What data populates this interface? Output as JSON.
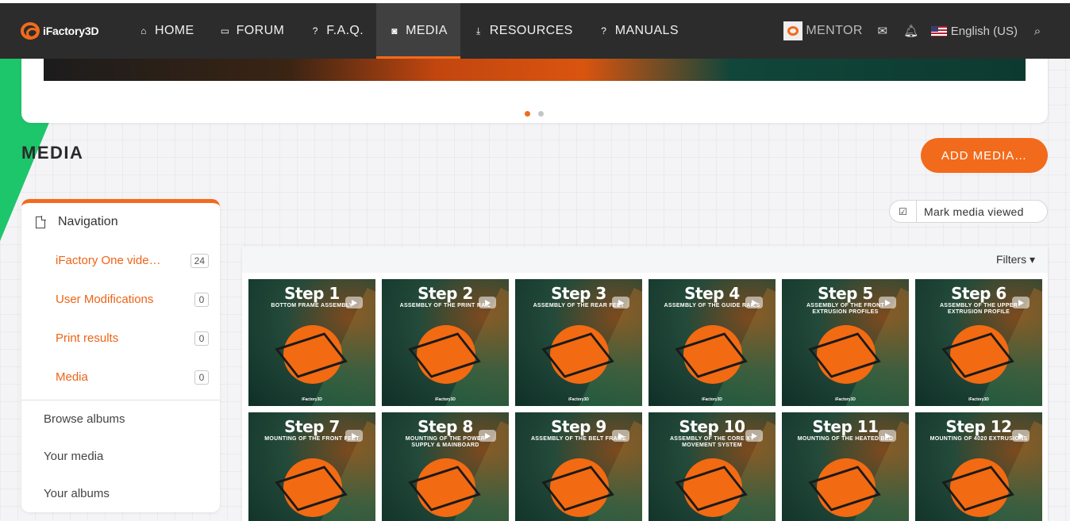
{
  "brand": {
    "name": "iFactory3D"
  },
  "nav": {
    "items": [
      {
        "label": "HOME",
        "icon": "home-icon",
        "glyph": "⌂",
        "active": false
      },
      {
        "label": "FORUM",
        "icon": "forum-icon",
        "glyph": "▭",
        "active": false
      },
      {
        "label": "F.A.Q.",
        "icon": "faq-icon",
        "glyph": "?",
        "active": false
      },
      {
        "label": "MEDIA",
        "icon": "camera-icon",
        "glyph": "◙",
        "active": true
      },
      {
        "label": "RESOURCES",
        "icon": "download-icon",
        "glyph": "⤓",
        "active": false
      },
      {
        "label": "MANUALS",
        "icon": "manual-icon",
        "glyph": "?",
        "active": false
      }
    ],
    "user": "MENTOR",
    "language": "English (US)",
    "accent_color": "#f26a1b"
  },
  "carousel": {
    "slides": 2,
    "active": 1
  },
  "page": {
    "title": "MEDIA",
    "add_media_label": "ADD MEDIA…"
  },
  "sidebar": {
    "title": "Navigation",
    "categories": [
      {
        "label": "iFactory One vide…",
        "count": "24"
      },
      {
        "label": "User Modifications",
        "count": "0"
      },
      {
        "label": "Print results",
        "count": "0"
      },
      {
        "label": "Media",
        "count": "0"
      }
    ],
    "links": [
      "Browse albums",
      "Your media",
      "Your albums"
    ]
  },
  "mark_viewed_label": "Mark media viewed",
  "gallery": {
    "filters_label": "Filters ▾",
    "logo_text": "iFactory3D",
    "tiles": [
      {
        "step": "Step 1",
        "subtitle": "BOTTOM FRAME ASSEMBLY"
      },
      {
        "step": "Step 2",
        "subtitle": "ASSEMBLY OF THE PRINT RAIL"
      },
      {
        "step": "Step 3",
        "subtitle": "ASSEMBLY OF THE REAR FEET"
      },
      {
        "step": "Step 4",
        "subtitle": "ASSEMBLY OF THE GUIDE RAILS"
      },
      {
        "step": "Step 5",
        "subtitle": "ASSEMBLY OF THE FRONT EXTRUSION PROFILES"
      },
      {
        "step": "Step 6",
        "subtitle": "ASSEMBLY OF THE UPPER EXTRUSION PROFILE"
      },
      {
        "step": "Step 7",
        "subtitle": "MOUNTING OF THE FRONT FEET"
      },
      {
        "step": "Step 8",
        "subtitle": "MOUNTING OF THE POWER SUPPLY & MAINBOARD"
      },
      {
        "step": "Step 9",
        "subtitle": "ASSEMBLY OF THE BELT FRAME"
      },
      {
        "step": "Step 10",
        "subtitle": "ASSEMBLY OF THE CORE XY MOVEMENT SYSTEM"
      },
      {
        "step": "Step 11",
        "subtitle": "MOUNTING OF THE HEATED BED"
      },
      {
        "step": "Step 12",
        "subtitle": "MOUNTING OF 4020 EXTRUSIONS"
      }
    ]
  }
}
